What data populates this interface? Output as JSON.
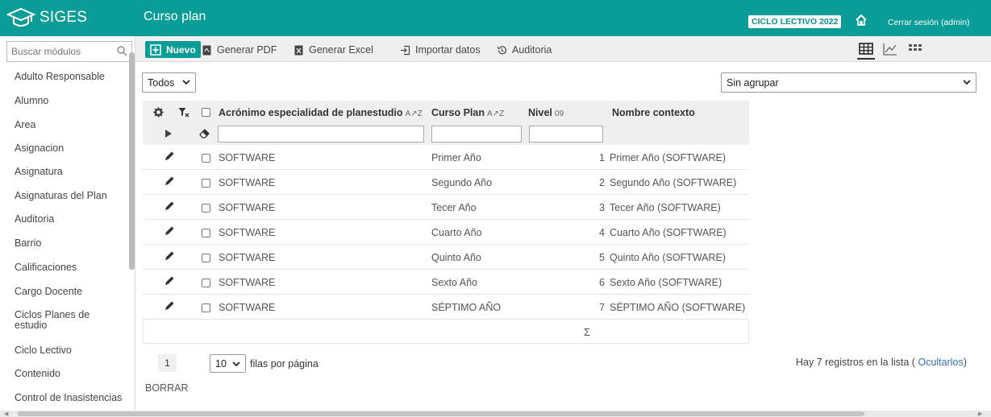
{
  "app": {
    "name": "SIGES"
  },
  "header": {
    "title": "Curso plan",
    "ciclo_badge": "CICLO LECTIVO 2022",
    "logout": "Cerrar sesión (admin)"
  },
  "sidebar": {
    "search_placeholder": "Buscar módulos",
    "items": [
      "Adulto Responsable",
      "Alumno",
      "Area",
      "Asignacion",
      "Asignatura",
      "Asignaturas del Plan",
      "Auditoria",
      "Barrio",
      "Calificaciones",
      "Cargo Docente",
      "Ciclos Planes de estudio",
      "Ciclo Lectivo",
      "Contenido",
      "Control de Inasistencias"
    ]
  },
  "toolbar": {
    "new": "Nuevo",
    "pdf": "Generar PDF",
    "excel": "Generar Excel",
    "import": "Importar datos",
    "audit": "Auditoria"
  },
  "filters": {
    "scope": "Todos",
    "grouping": "Sin agrupar"
  },
  "table": {
    "columns": {
      "acronym": "Acrónimo especialidad de planestudio",
      "course": "Curso Plan",
      "level": "Nivel",
      "context": "Nombre contexto"
    },
    "sort_alpha": "A͏Z",
    "sort_num": "09",
    "rows": [
      {
        "acronym": "SOFTWARE",
        "course": "Primer Año",
        "level": "1",
        "context": "Primer Año (SOFTWARE)"
      },
      {
        "acronym": "SOFTWARE",
        "course": "Segundo Año",
        "level": "2",
        "context": "Segundo Año (SOFTWARE)"
      },
      {
        "acronym": "SOFTWARE",
        "course": "Tecer Año",
        "level": "3",
        "context": "Tecer Año (SOFTWARE)"
      },
      {
        "acronym": "SOFTWARE",
        "course": "Cuarto Año",
        "level": "4",
        "context": "Cuarto Año (SOFTWARE)"
      },
      {
        "acronym": "SOFTWARE",
        "course": "Quinto Año",
        "level": "5",
        "context": "Quinto Año (SOFTWARE)"
      },
      {
        "acronym": "SOFTWARE",
        "course": "Sexto Año",
        "level": "6",
        "context": "Sexto Año (SOFTWARE)"
      },
      {
        "acronym": "SOFTWARE",
        "course": "SÉPTIMO AÑO",
        "level": "7",
        "context": "SÉPTIMO AÑO (SOFTWARE)"
      }
    ],
    "sum_symbol": "Σ"
  },
  "pager": {
    "current_page": "1",
    "per_page": "10",
    "per_page_label": "filas por página",
    "clear": "BORRAR",
    "records_text": "Hay 7 registros en la lista (",
    "hide_link": "Ocultarlos",
    "records_close": ")"
  },
  "colors": {
    "accent": "#0a9d97"
  }
}
